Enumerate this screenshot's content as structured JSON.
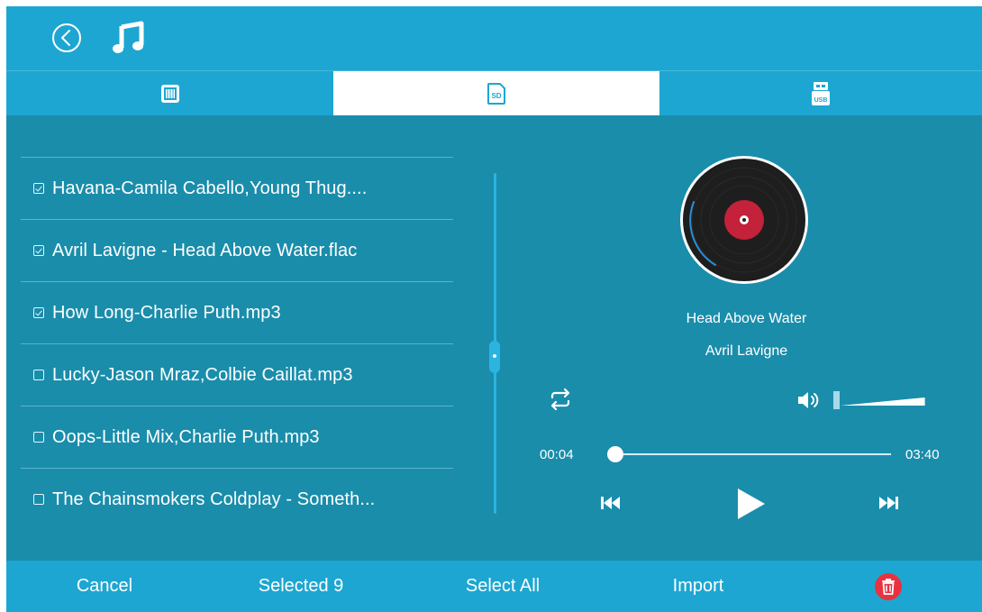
{
  "tabs": [
    {
      "icon": "chip-memory-icon"
    },
    {
      "icon": "sd-card-icon",
      "label": "SD",
      "active": true
    },
    {
      "icon": "usb-drive-icon",
      "label": "USB"
    }
  ],
  "songs": [
    {
      "title": "Havana-Camila Cabello,Young Thug....",
      "checked": true
    },
    {
      "title": "Avril Lavigne - Head Above Water.flac",
      "checked": true
    },
    {
      "title": "How Long-Charlie Puth.mp3",
      "checked": true
    },
    {
      "title": "Lucky-Jason Mraz,Colbie Caillat.mp3",
      "checked": false
    },
    {
      "title": "Oops-Little Mix,Charlie Puth.mp3",
      "checked": false
    },
    {
      "title": "The Chainsmokers Coldplay - Someth...",
      "checked": false
    }
  ],
  "player": {
    "title": "Head Above Water",
    "artist": "Avril Lavigne",
    "current_time": "00:04",
    "total_time": "03:40",
    "progress": 0.02,
    "volume": 0.9
  },
  "bottom": {
    "cancel": "Cancel",
    "selected": "Selected 9",
    "select_all": "Select All",
    "import": "Import"
  },
  "colors": {
    "bar": "#1da6d2",
    "content": "#1a8dab",
    "accent": "#2bb4e0",
    "delete": "#e8333e"
  }
}
